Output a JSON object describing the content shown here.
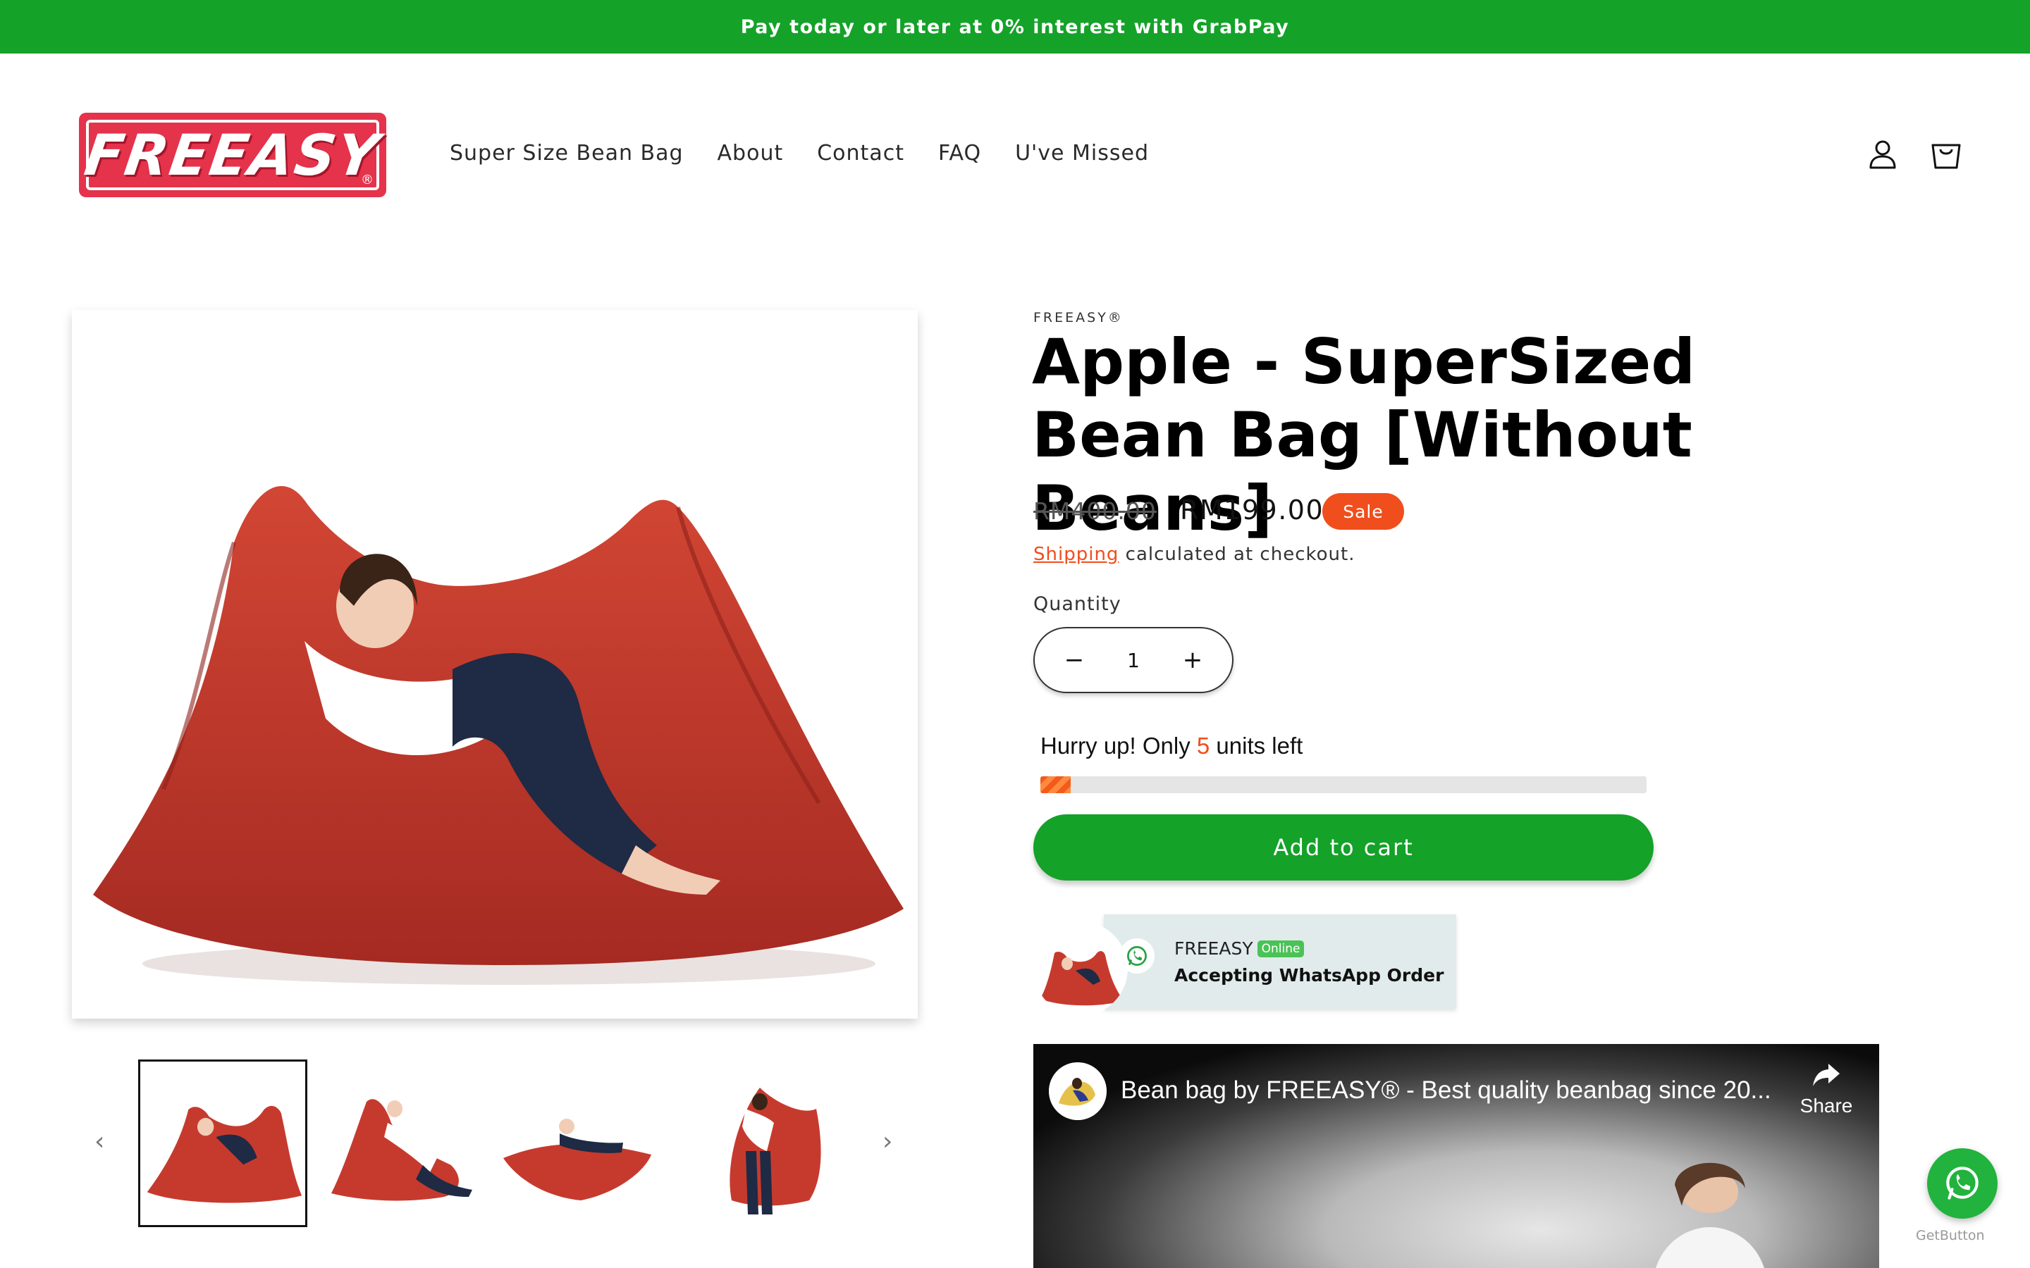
{
  "announcement": {
    "text": "Pay today or later at 0% interest with GrabPay"
  },
  "header": {
    "logo_text": "FREEASY",
    "logo_mark": "®",
    "nav": [
      "Super Size Bean Bag",
      "About",
      "Contact",
      "FAQ",
      "U've Missed"
    ],
    "icons": [
      "account-icon",
      "cart-icon"
    ]
  },
  "product": {
    "vendor": "FREEASY®",
    "title": "Apple - SuperSized Bean Bag [Without Beans]",
    "price_regular": "RM400.00",
    "price_sale": "RM199.00",
    "sale_badge": "Sale",
    "shipping_link": "Shipping",
    "shipping_text": " calculated at checkout.",
    "quantity_label": "Quantity",
    "quantity_value": "1",
    "decrease_symbol": "−",
    "increase_symbol": "+",
    "stock_prefix": "Hurry up! Only ",
    "stock_count": "5",
    "stock_suffix": " units left",
    "stock_fraction": 0.05,
    "add_to_cart": "Add to cart"
  },
  "gallery": {
    "thumbnail_count": 4,
    "prev_arrow": "‹",
    "next_arrow": "›"
  },
  "whatsapp_card": {
    "name": "FREEASY",
    "online_badge": "Online",
    "status": "Accepting WhatsApp Order"
  },
  "video": {
    "title": "Bean bag by FREEASY® - Best quality beanbag since 20...",
    "share_label": "Share"
  },
  "widget": {
    "credit": "GetButton"
  },
  "colors": {
    "brand_green": "#14a229",
    "brand_red": "#e4334b",
    "sale_orange": "#f04e1c",
    "beanbag_red": "#c63a2e"
  }
}
